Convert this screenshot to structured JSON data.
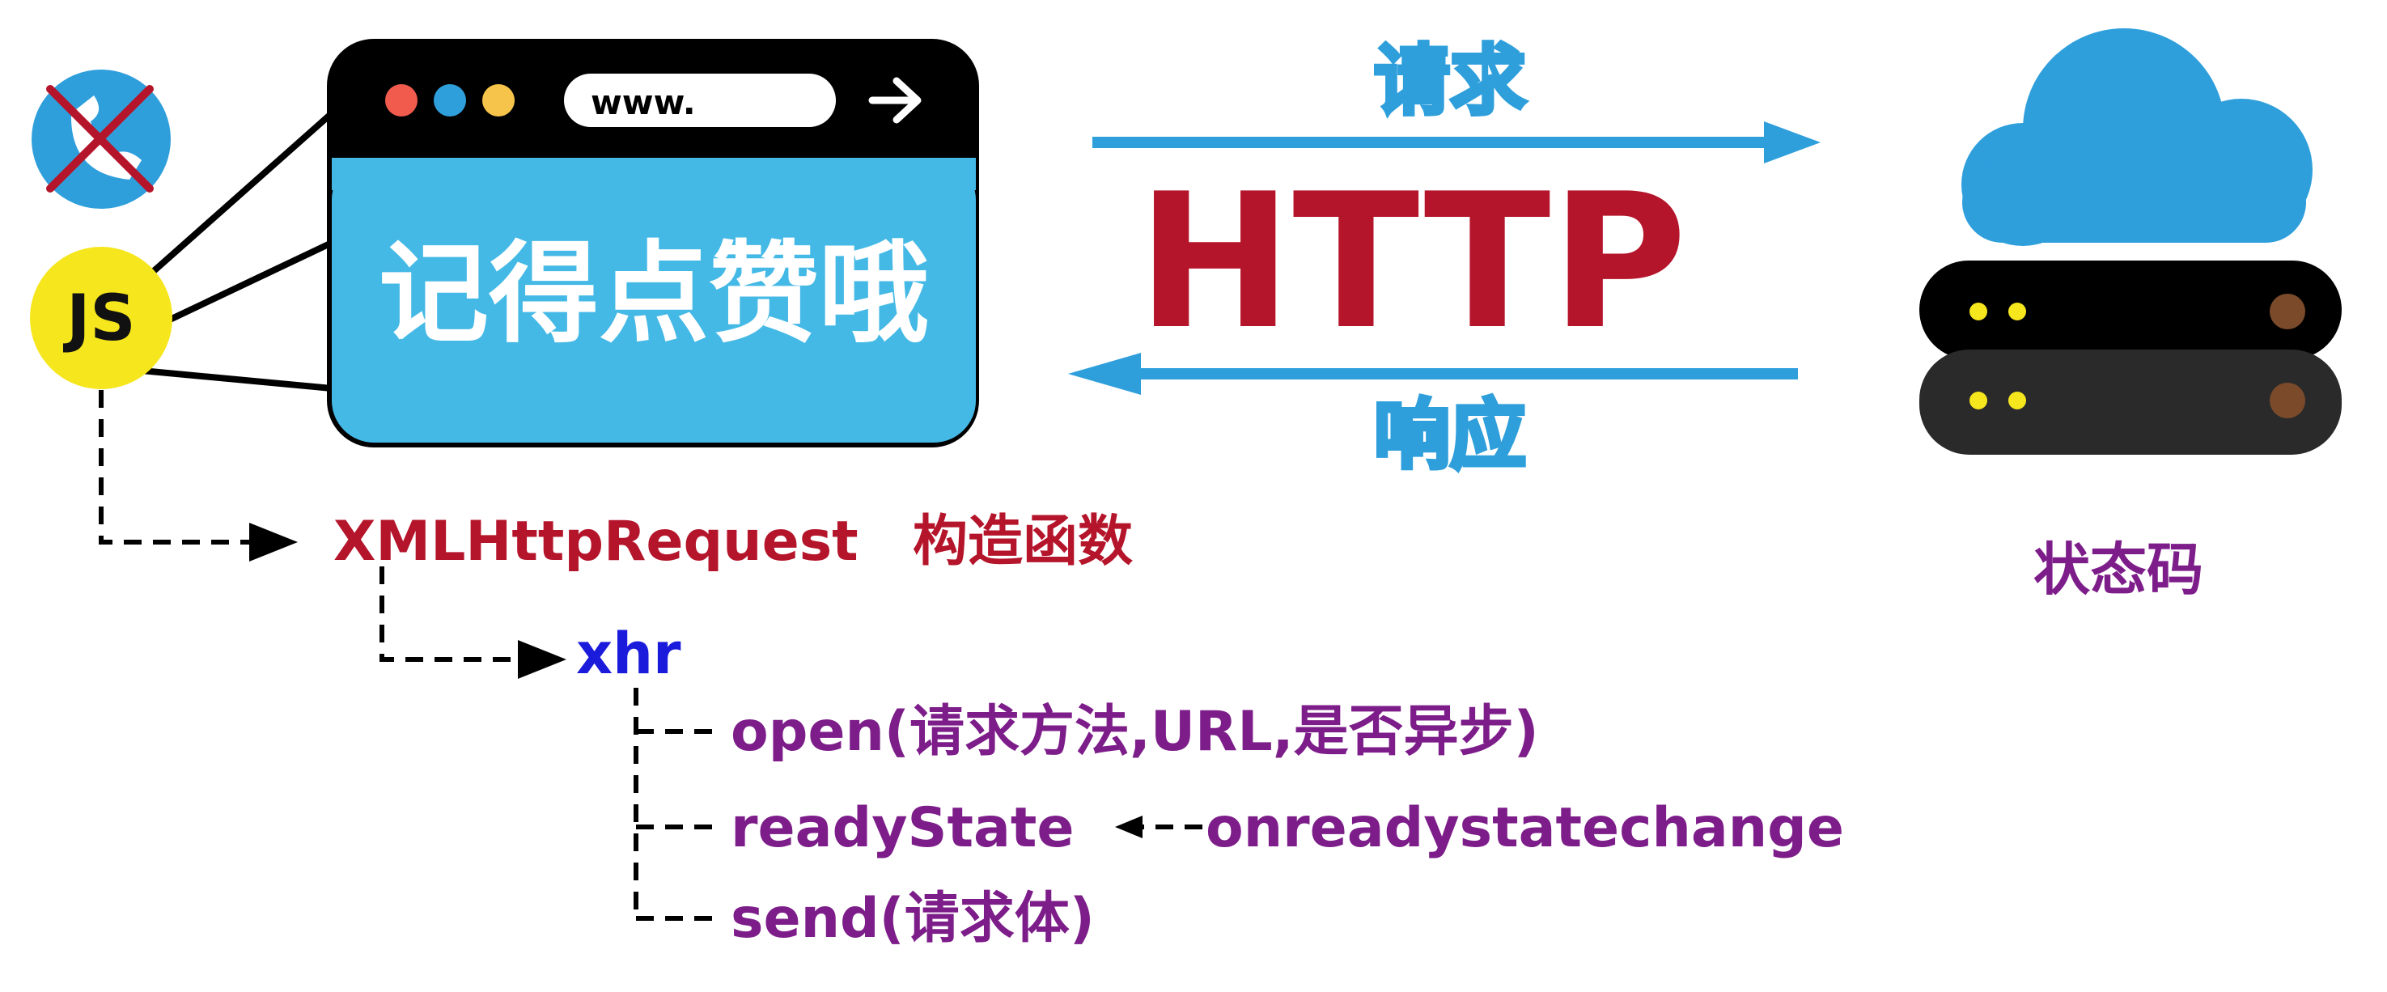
{
  "browser": {
    "url_text": "www.",
    "banner_text": "记得点赞哦"
  },
  "badges": {
    "js_label": "JS"
  },
  "http": {
    "request_label": "请求",
    "protocol_label": "HTTP",
    "response_label": "响应"
  },
  "server": {
    "status_label": "状态码"
  },
  "tree": {
    "root_label": "XMLHttpRequest",
    "root_note": "构造函数",
    "instance_label": "xhr",
    "open_label": "open(请求方法,URL,是否异步)",
    "ready_state_label": "readyState",
    "ready_state_event_label": "onreadystatechange",
    "send_label": "send(请求体)"
  },
  "colors": {
    "dark_red": "#b5152b",
    "purple": "#7d1d8a",
    "blue": "#1b1bdc",
    "sky_blue": "#45b9e6",
    "cloud_blue": "#2f9fdc",
    "yellow": "#f6e61d",
    "black": "#000000"
  }
}
